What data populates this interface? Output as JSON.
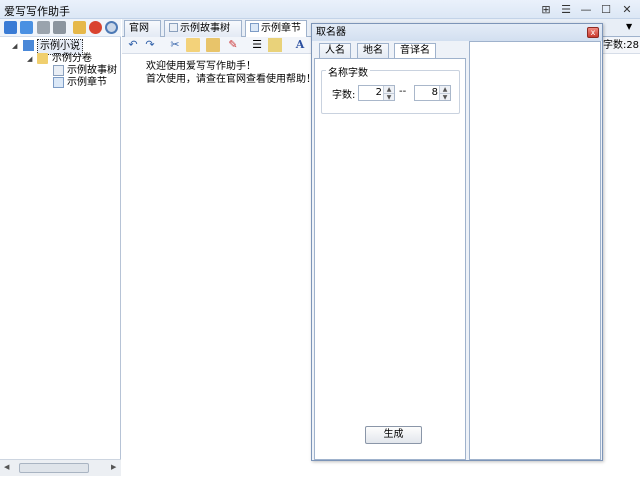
{
  "window": {
    "title": "爱写写作助手",
    "controls": [
      "⊞",
      "☰",
      "—",
      "☐",
      "✕"
    ]
  },
  "tree": {
    "nodes": [
      {
        "label": "示例小说",
        "icon": "book-icon"
      },
      {
        "label": "示例分卷",
        "icon": "folder-icon"
      },
      {
        "label": "示例故事树",
        "icon": "tree-doc-icon"
      },
      {
        "label": "示例章节",
        "icon": "doc-icon"
      }
    ]
  },
  "tabs": [
    {
      "label": "官网"
    },
    {
      "label": "示例故事树"
    },
    {
      "label": "示例章节"
    }
  ],
  "editor": {
    "lines": [
      "欢迎使用爱写写作助手！",
      "首次使用，请查在官网查看使用帮助！"
    ]
  },
  "status": {
    "word_count": "字数:28"
  },
  "dialog": {
    "title": "取名器",
    "tabs": [
      {
        "label": "人名"
      },
      {
        "label": "地名"
      },
      {
        "label": "音译名"
      }
    ],
    "group_label": "名称字数",
    "field_label": "字数:",
    "min_value": "2",
    "separator": "--",
    "max_value": "8",
    "generate_label": "生成",
    "close_glyph": "x"
  },
  "colors": {
    "titlebar": "#dce7f5",
    "accent_border": "#9fb2cc",
    "close_red": "#c93a2e"
  }
}
